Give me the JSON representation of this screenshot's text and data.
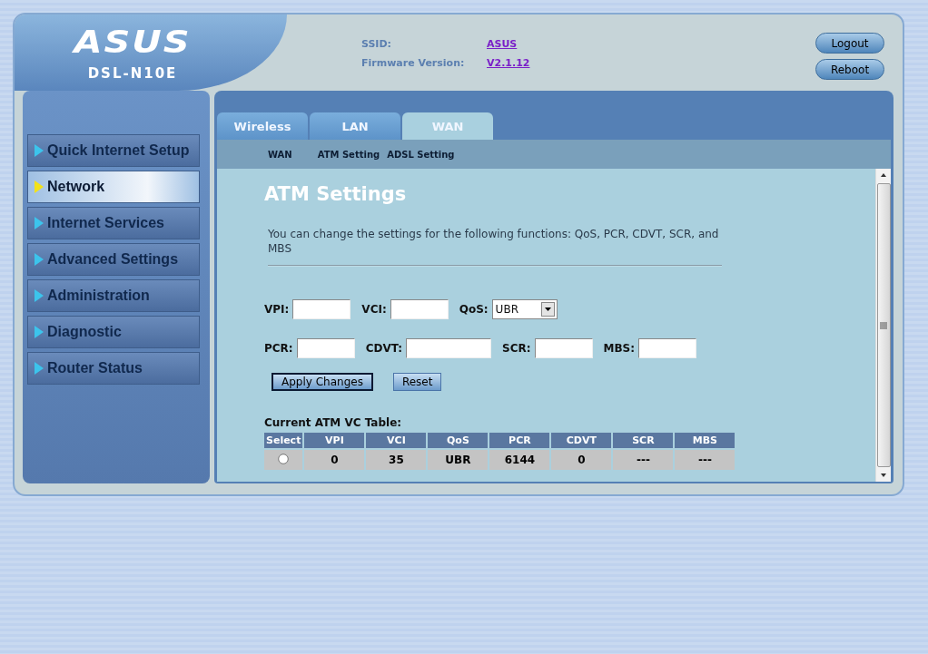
{
  "header": {
    "logo": "ASUS",
    "model": "DSL-N10E",
    "info": [
      {
        "label": "SSID:",
        "value": "ASUS"
      },
      {
        "label": "Firmware Version:",
        "value": "V2.1.12"
      }
    ],
    "buttons": [
      "Logout",
      "Reboot"
    ]
  },
  "sidebar": {
    "items": [
      {
        "label": "Quick Internet Setup",
        "selected": false
      },
      {
        "label": "Network",
        "selected": true
      },
      {
        "label": "Internet Services",
        "selected": false
      },
      {
        "label": "Advanced Settings",
        "selected": false
      },
      {
        "label": "Administration",
        "selected": false
      },
      {
        "label": "Diagnostic",
        "selected": false
      },
      {
        "label": "Router Status",
        "selected": false
      }
    ]
  },
  "tabs": [
    {
      "label": "Wireless",
      "selected": false
    },
    {
      "label": "LAN",
      "selected": false
    },
    {
      "label": "WAN",
      "selected": true
    }
  ],
  "subnav": [
    "WAN",
    "ATM Setting",
    "ADSL Setting"
  ],
  "content": {
    "heading": "ATM Settings",
    "description": "You can change the settings for the following functions: QoS, PCR, CDVT, SCR, and MBS",
    "field_rows": [
      [
        {
          "label": "VPI:",
          "kind": "text"
        },
        {
          "label": "VCI:",
          "kind": "text"
        },
        {
          "label": "QoS:",
          "kind": "select",
          "value": "UBR"
        }
      ],
      [
        {
          "label": "PCR:",
          "kind": "text"
        },
        {
          "label": "CDVT:",
          "kind": "wide"
        },
        {
          "label": "SCR:",
          "kind": "text"
        },
        {
          "label": "MBS:",
          "kind": "text"
        }
      ]
    ],
    "buttons": [
      {
        "label": "Apply Changes",
        "focused": true
      },
      {
        "label": "Reset",
        "focused": false
      }
    ],
    "table": {
      "title": "Current ATM VC Table:",
      "columns": [
        "Select",
        "VPI",
        "VCI",
        "QoS",
        "PCR",
        "CDVT",
        "SCR",
        "MBS"
      ],
      "rows": [
        {
          "selected": false,
          "cells": [
            "",
            "0",
            "35",
            "UBR",
            "6144",
            "0",
            "---",
            "---"
          ]
        }
      ]
    }
  }
}
